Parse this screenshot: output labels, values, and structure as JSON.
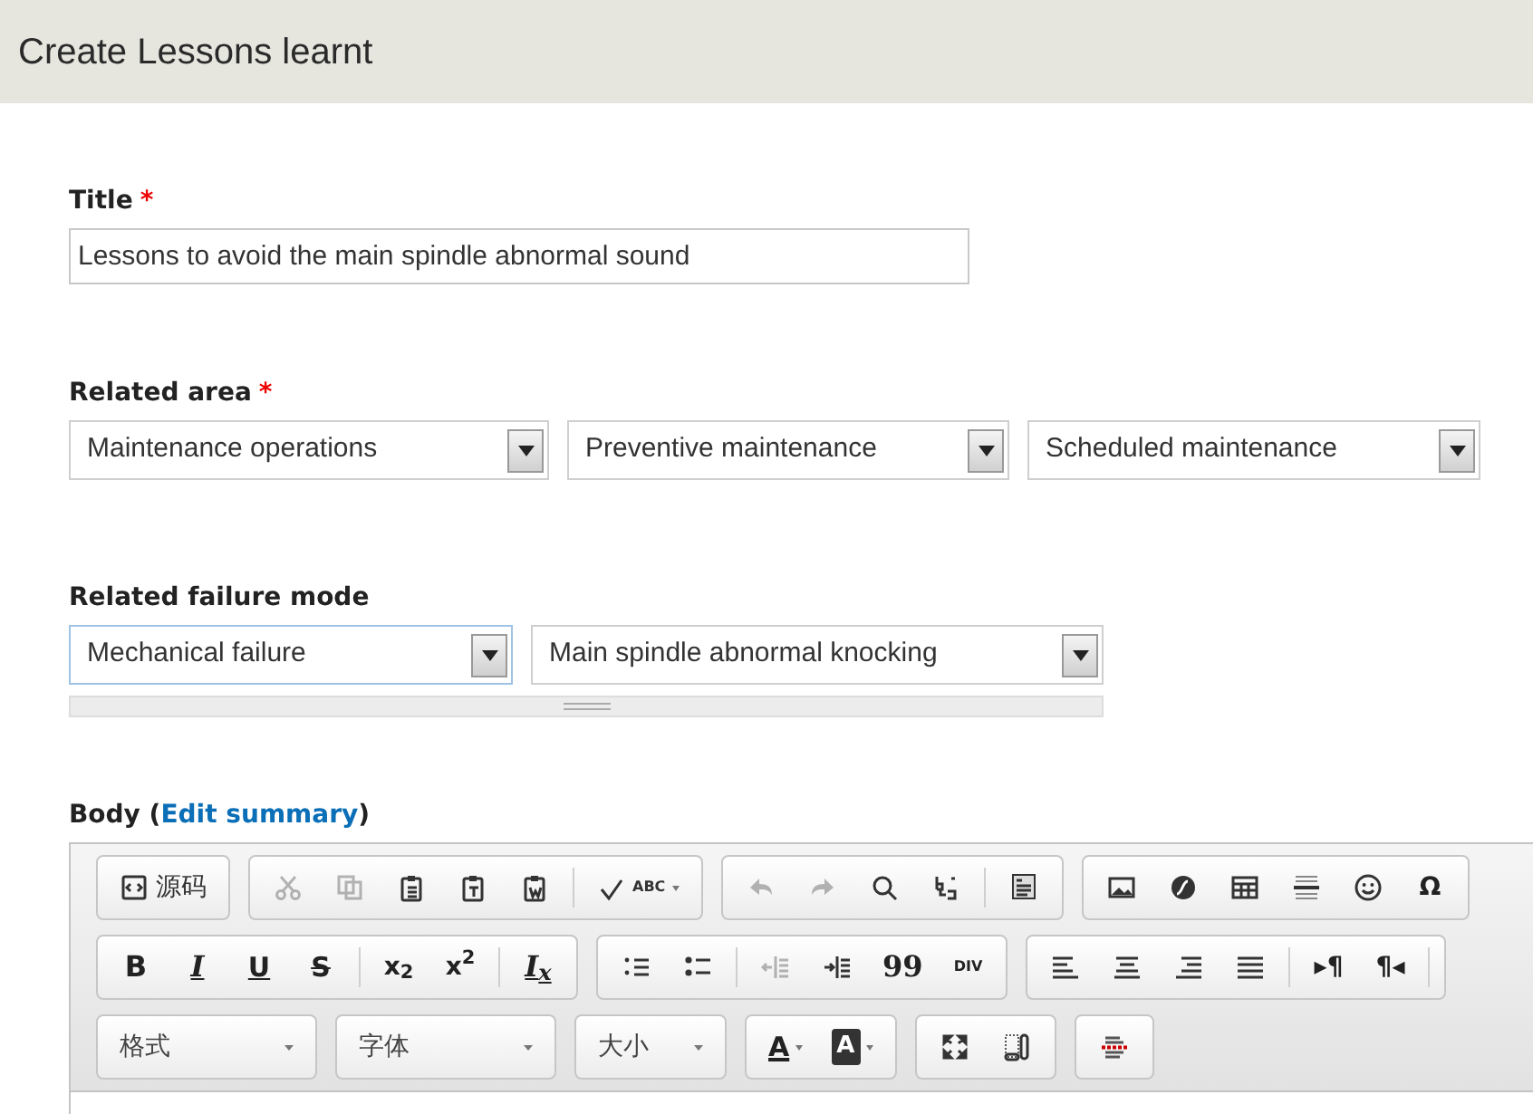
{
  "page_title": "Create Lessons learnt",
  "title_field": {
    "label": "Title",
    "required_mark": "*",
    "value": "Lessons to avoid the main spindle abnormal sound"
  },
  "related_area": {
    "label": "Related area",
    "required_mark": "*",
    "selects": [
      {
        "value": "Maintenance operations",
        "focused": false
      },
      {
        "value": "Preventive maintenance",
        "focused": false
      },
      {
        "value": "Scheduled maintenance",
        "focused": false
      }
    ]
  },
  "related_failure_mode": {
    "label": "Related failure mode",
    "selects": [
      {
        "value": "Mechanical failure",
        "focused": true
      },
      {
        "value": "Main spindle abnormal knocking",
        "focused": false
      }
    ]
  },
  "body": {
    "label": "Body",
    "link_open": "(",
    "link": "Edit summary",
    "link_close": ")"
  },
  "toolbar": [
    [
      [
        {
          "kind": "source",
          "label": "源码",
          "disabled": false
        }
      ],
      [
        {
          "kind": "cut",
          "disabled": true
        },
        {
          "kind": "copy",
          "disabled": true
        },
        {
          "kind": "paste",
          "disabled": false
        },
        {
          "kind": "pastetext",
          "disabled": false
        },
        {
          "kind": "pasteword",
          "disabled": false
        },
        {
          "kind": "sep"
        },
        {
          "kind": "spell",
          "label": "ABC",
          "disabled": false
        }
      ],
      [
        {
          "kind": "undo",
          "disabled": true
        },
        {
          "kind": "redo",
          "disabled": true
        },
        {
          "kind": "find",
          "disabled": false
        },
        {
          "kind": "replace",
          "disabled": false
        },
        {
          "kind": "sep"
        },
        {
          "kind": "selectall",
          "disabled": false
        }
      ],
      [
        {
          "kind": "image",
          "disabled": false
        },
        {
          "kind": "flash",
          "disabled": false
        },
        {
          "kind": "table",
          "disabled": false
        },
        {
          "kind": "hr",
          "disabled": false
        },
        {
          "kind": "smiley",
          "disabled": false
        },
        {
          "kind": "text",
          "label": "Ω",
          "disabled": false
        }
      ]
    ],
    [
      [
        {
          "kind": "bold",
          "label": "B",
          "disabled": false
        },
        {
          "kind": "italic",
          "label": "I",
          "disabled": false
        },
        {
          "kind": "underline",
          "label": "U",
          "disabled": false
        },
        {
          "kind": "strike",
          "label": "S",
          "disabled": false
        },
        {
          "kind": "sep"
        },
        {
          "kind": "text",
          "label": "x$_{2}$",
          "disabled": false
        },
        {
          "kind": "text",
          "label": "x$^{2}$",
          "disabled": false
        },
        {
          "kind": "sep"
        },
        {
          "kind": "italic",
          "label": "I$_{x}$",
          "disabled": false
        }
      ],
      [
        {
          "kind": "ol",
          "disabled": false
        },
        {
          "kind": "ul",
          "disabled": false
        },
        {
          "kind": "sep"
        },
        {
          "kind": "outdent",
          "disabled": true
        },
        {
          "kind": "indent",
          "disabled": false
        },
        {
          "kind": "quote",
          "label": "99",
          "disabled": false
        },
        {
          "kind": "div",
          "label": "DIV",
          "disabled": false
        }
      ],
      [
        {
          "kind": "left",
          "disabled": false
        },
        {
          "kind": "center",
          "disabled": false
        },
        {
          "kind": "right",
          "disabled": false
        },
        {
          "kind": "justify",
          "disabled": false
        },
        {
          "kind": "sep"
        },
        {
          "kind": "text",
          "label": "▸¶",
          "disabled": false
        },
        {
          "kind": "text",
          "label": "¶◂",
          "disabled": false
        },
        {
          "kind": "sep"
        }
      ]
    ],
    [
      [
        {
          "kind": "combo",
          "label": "格式",
          "wide": true
        }
      ],
      [
        {
          "kind": "combo",
          "label": "字体",
          "wide": true
        }
      ],
      [
        {
          "kind": "combo",
          "label": "大小",
          "wide": false
        }
      ],
      [
        {
          "kind": "textcolor",
          "label": "A",
          "disabled": false
        },
        {
          "kind": "bgcolor",
          "label": "A",
          "disabled": false
        }
      ],
      [
        {
          "kind": "maximize",
          "disabled": false
        },
        {
          "kind": "blocks",
          "disabled": false
        }
      ],
      [
        {
          "kind": "pagebreak",
          "disabled": false
        }
      ]
    ]
  ]
}
